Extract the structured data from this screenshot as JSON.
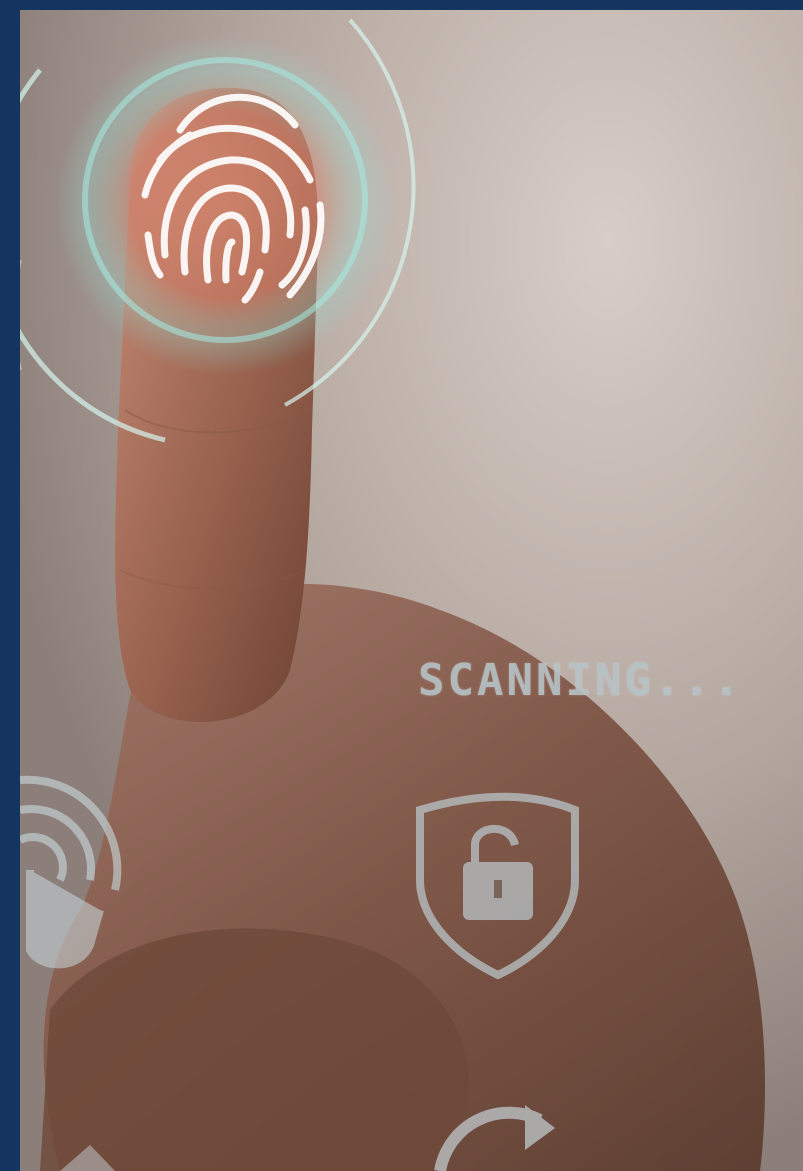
{
  "overlay": {
    "status_text": "SCANNING...",
    "border_color": "#13355f",
    "ring_color": "#8fe0d6"
  },
  "icons": {
    "fingerprint": "fingerprint-icon",
    "padlock_shield": "padlock-shield-icon",
    "touch": "touch-gesture-icon",
    "refresh": "refresh-icon"
  }
}
